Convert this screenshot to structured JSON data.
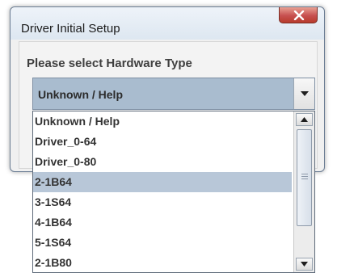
{
  "window": {
    "title": "Driver Initial Setup",
    "close_icon": "close-icon"
  },
  "form": {
    "prompt": "Please select Hardware Type",
    "selected_value": "Unknown / Help"
  },
  "dropdown": {
    "options": [
      "Unknown / Help",
      "Driver_0-64",
      "Driver_0-80",
      "2-1B64",
      "3-1S64",
      "4-1B64",
      "5-1S64",
      "2-1B80"
    ],
    "highlighted_option": "2-1B64"
  },
  "colors": {
    "highlight": "#b8c7d8",
    "combo_background": "#a9bccf",
    "close_button": "#c75050"
  }
}
